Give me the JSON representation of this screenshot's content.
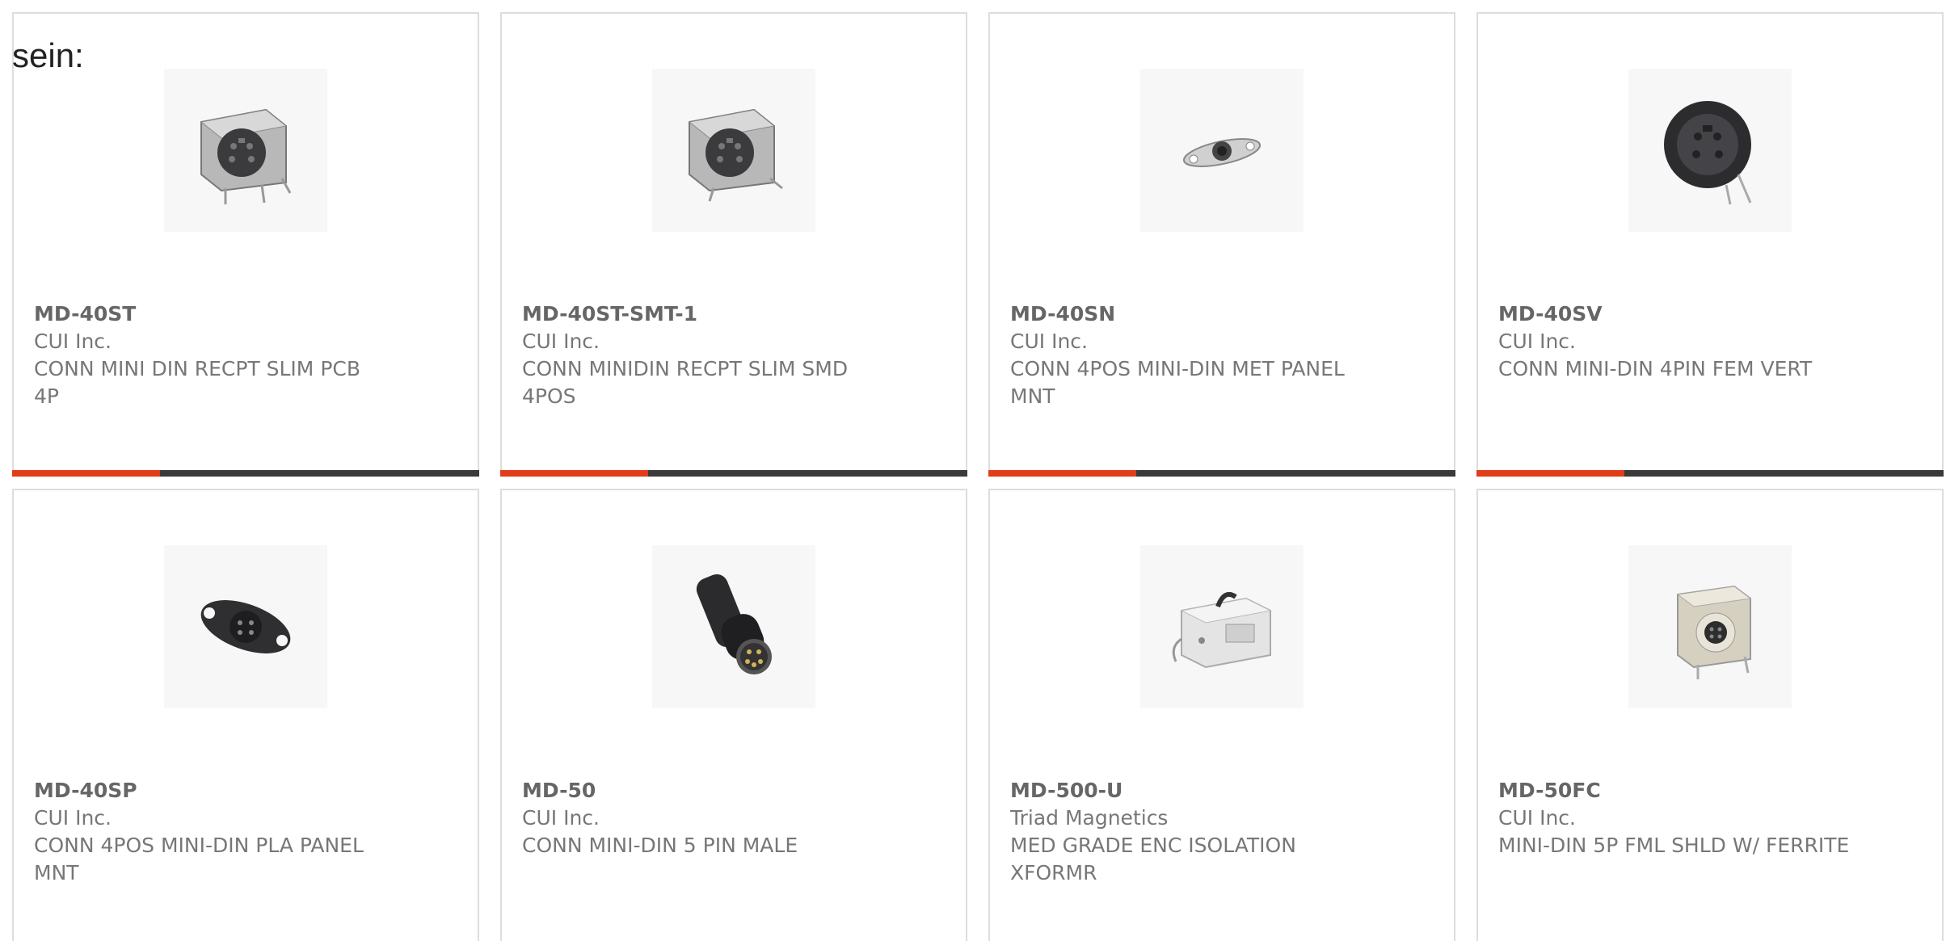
{
  "page": {
    "prefix_text": "sein:"
  },
  "colors": {
    "accent": "#e03e1a",
    "bar": "#3a3a3a",
    "border": "#dddddd",
    "text": "#777777"
  },
  "products": [
    {
      "part": "MD-40ST",
      "mfr": "CUI Inc.",
      "desc": "CONN MINI DIN RECPT SLIM PCB 4P",
      "image_icon": "mini-din-pcb-receptacle-icon"
    },
    {
      "part": "MD-40ST-SMT-1",
      "mfr": "CUI Inc.",
      "desc": "CONN MINIDIN RECPT SLIM SMD 4POS",
      "image_icon": "mini-din-smd-receptacle-icon"
    },
    {
      "part": "MD-40SN",
      "mfr": "CUI Inc.",
      "desc": "CONN 4POS MINI-DIN MET PANEL MNT",
      "image_icon": "mini-din-metal-panel-icon"
    },
    {
      "part": "MD-40SV",
      "mfr": "CUI Inc.",
      "desc": "CONN MINI-DIN 4PIN FEM VERT",
      "image_icon": "mini-din-vertical-icon"
    },
    {
      "part": "MD-40SP",
      "mfr": "CUI Inc.",
      "desc": "CONN 4POS MINI-DIN PLA PANEL MNT",
      "image_icon": "mini-din-plastic-panel-icon"
    },
    {
      "part": "MD-50",
      "mfr": "CUI Inc.",
      "desc": "CONN MINI-DIN 5 PIN MALE",
      "image_icon": "mini-din-male-plug-icon"
    },
    {
      "part": "MD-500-U",
      "mfr": "Triad Magnetics",
      "desc": "MED GRADE ENC ISOLATION XFORMR",
      "image_icon": "isolation-transformer-icon"
    },
    {
      "part": "MD-50FC",
      "mfr": "CUI Inc.",
      "desc": "MINI-DIN 5P FML SHLD W/ FERRITE",
      "image_icon": "mini-din-shielded-ferrite-icon"
    }
  ]
}
